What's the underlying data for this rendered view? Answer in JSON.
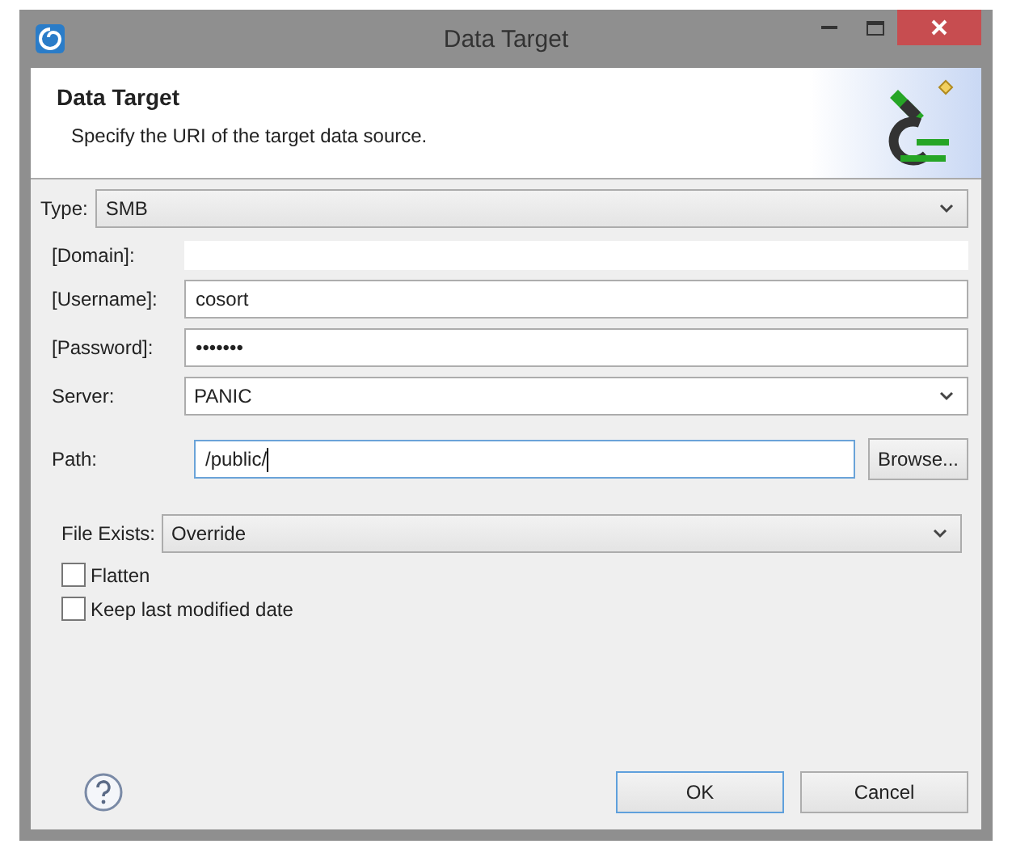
{
  "window": {
    "title": "Data Target"
  },
  "header": {
    "title": "Data Target",
    "description": "Specify the URI of the target data source."
  },
  "type": {
    "label": "Type:",
    "value": "SMB"
  },
  "fields": [
    {
      "kind": "flat",
      "label": "[Domain]:"
    },
    {
      "kind": "text",
      "label": "[Username]:",
      "value": "cosort"
    },
    {
      "kind": "text",
      "label": "[Password]:",
      "value": "•••••••"
    },
    {
      "kind": "combo",
      "label": "Server:",
      "value": "PANIC"
    }
  ],
  "path": {
    "label": "Path:",
    "value": "/public/",
    "focused": true,
    "button": "Browse..."
  },
  "file_exists": {
    "label": "File Exists:",
    "value": "Override"
  },
  "checkboxes": [
    {
      "label": "Flatten",
      "checked": false
    },
    {
      "label": "Keep last modified date",
      "checked": false
    }
  ],
  "buttons": [
    {
      "label": "OK",
      "default": true
    },
    {
      "label": "Cancel",
      "default": false
    }
  ]
}
